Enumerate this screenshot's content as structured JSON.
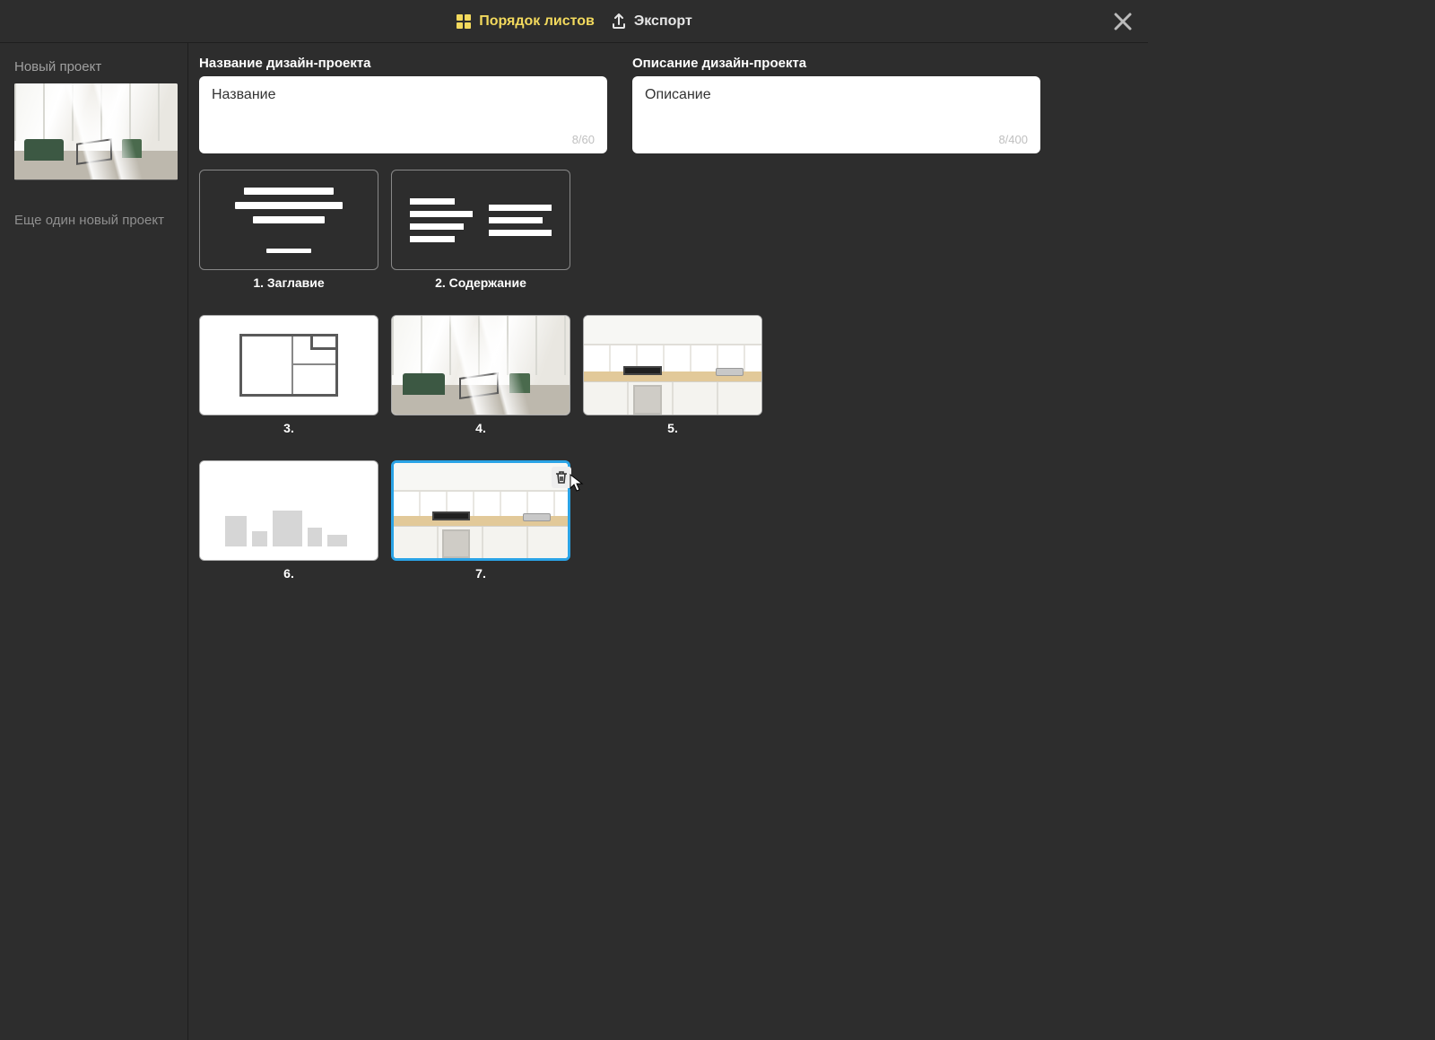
{
  "topbar": {
    "tab_sheets": "Порядок листов",
    "tab_export": "Экспорт"
  },
  "sidebar": {
    "project_current": "Новый проект",
    "project_other": "Еще один новый проект"
  },
  "fields": {
    "name_label": "Название дизайн-проекта",
    "name_value": "Название",
    "name_counter": "8/60",
    "desc_label": "Описание дизайн-проекта",
    "desc_value": "Описание",
    "desc_counter": "8/400"
  },
  "pages": {
    "p1": "1. Заглавие",
    "p2": "2. Содержание",
    "p3": "3.",
    "p4": "4.",
    "p5": "5.",
    "p6": "6.",
    "p7": "7."
  }
}
